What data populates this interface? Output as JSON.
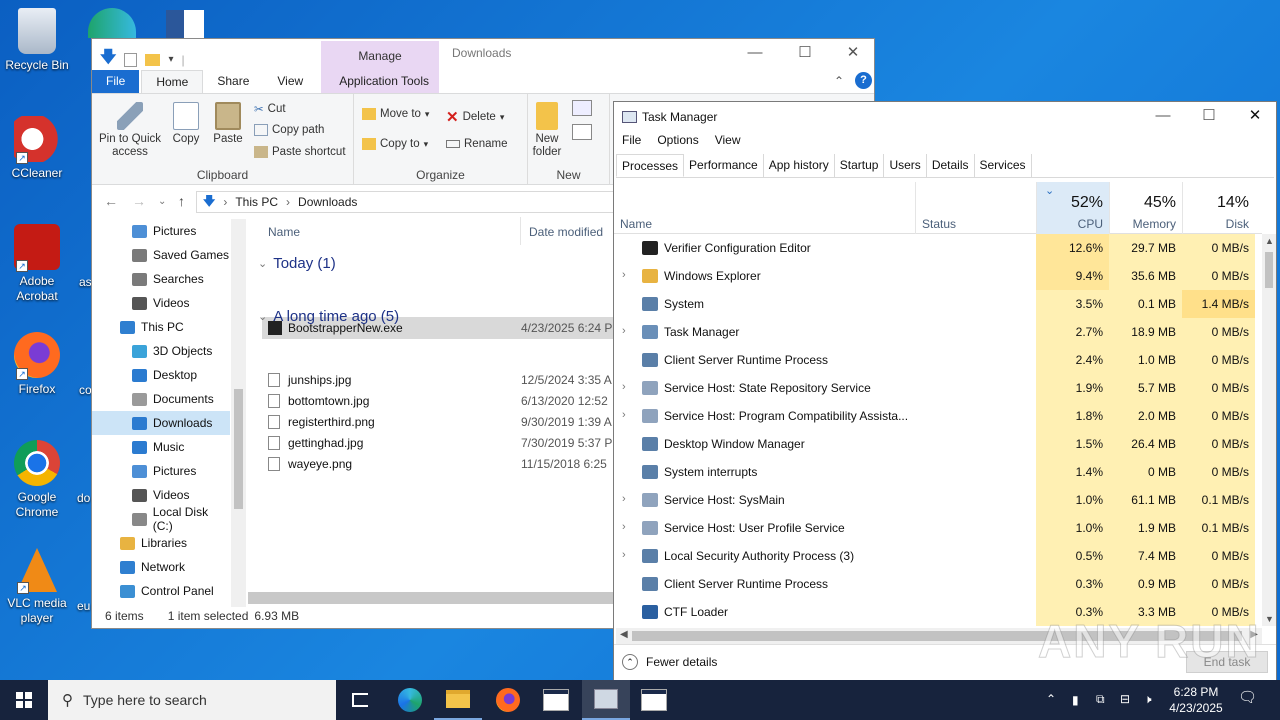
{
  "desktop": {
    "icons": [
      {
        "label": "Recycle Bin",
        "icon": "recycle-bin-icon"
      },
      {
        "label": "CCleaner",
        "icon": "ccleaner-icon"
      },
      {
        "label": "Adobe Acrobat",
        "icon": "acrobat-icon"
      },
      {
        "label": "Firefox",
        "icon": "firefox-icon"
      },
      {
        "label": "Google Chrome",
        "icon": "chrome-icon"
      },
      {
        "label": "VLC media player",
        "icon": "vlc-icon"
      }
    ],
    "partial_labels": [
      "as",
      "co",
      "do",
      "eu"
    ]
  },
  "explorer": {
    "title": "Downloads",
    "manage_label": "Manage",
    "tabs": [
      "File",
      "Home",
      "Share",
      "View",
      "Application Tools"
    ],
    "ribbon": {
      "pin": "Pin to Quick access",
      "copy": "Copy",
      "paste": "Paste",
      "cut": "Cut",
      "copy_path": "Copy path",
      "paste_shortcut": "Paste shortcut",
      "clipboard": "Clipboard",
      "move_to": "Move to",
      "copy_to": "Copy to",
      "delete": "Delete",
      "rename": "Rename",
      "organize": "Organize",
      "new_folder": "New folder",
      "new": "New"
    },
    "address": [
      "This PC",
      "Downloads"
    ],
    "nav": [
      {
        "label": "Pictures",
        "color": "#4d8fd6"
      },
      {
        "label": "Saved Games",
        "color": "#7a7a7a"
      },
      {
        "label": "Searches",
        "color": "#7a7a7a"
      },
      {
        "label": "Videos",
        "color": "#555"
      },
      {
        "label": "This PC",
        "color": "#2f7fd0"
      },
      {
        "label": "3D Objects",
        "color": "#3aa3d9"
      },
      {
        "label": "Desktop",
        "color": "#2b7bd0"
      },
      {
        "label": "Documents",
        "color": "#9a9a9a"
      },
      {
        "label": "Downloads",
        "color": "#2b7bd0"
      },
      {
        "label": "Music",
        "color": "#2b7bd0"
      },
      {
        "label": "Pictures",
        "color": "#4d8fd6"
      },
      {
        "label": "Videos",
        "color": "#555"
      },
      {
        "label": "Local Disk (C:)",
        "color": "#888"
      },
      {
        "label": "Libraries",
        "color": "#e8b341"
      },
      {
        "label": "Network",
        "color": "#2f7fd0"
      },
      {
        "label": "Control Panel",
        "color": "#3b8fd3"
      }
    ],
    "columns": {
      "name": "Name",
      "date": "Date modified"
    },
    "groups": [
      {
        "title": "Today (1)",
        "files": [
          {
            "name": "BootstrapperNew.exe",
            "date": "4/23/2025 6:24 P"
          }
        ]
      },
      {
        "title": "A long time ago (5)",
        "files": [
          {
            "name": "junships.jpg",
            "date": "12/5/2024 3:35 A"
          },
          {
            "name": "bottomtown.jpg",
            "date": "6/13/2020 12:52"
          },
          {
            "name": "registerthird.png",
            "date": "9/30/2019 1:39 A"
          },
          {
            "name": "gettinghad.jpg",
            "date": "7/30/2019 5:37 P"
          },
          {
            "name": "wayeye.png",
            "date": "11/15/2018 6:25"
          }
        ]
      }
    ],
    "status": {
      "items": "6 items",
      "selected": "1 item selected",
      "size": "6.93 MB"
    }
  },
  "taskmgr": {
    "title": "Task Manager",
    "menu": [
      "File",
      "Options",
      "View"
    ],
    "tabs": [
      "Processes",
      "Performance",
      "App history",
      "Startup",
      "Users",
      "Details",
      "Services"
    ],
    "headers": {
      "name": "Name",
      "status": "Status",
      "cpu_pct": "52%",
      "cpu": "CPU",
      "mem_pct": "45%",
      "mem": "Memory",
      "disk_pct": "14%",
      "disk": "Disk"
    },
    "rows": [
      {
        "name": "Verifier Configuration Editor",
        "exp": false,
        "cpu": "12.6%",
        "mem": "29.7 MB",
        "disk": "0 MB/s",
        "icon": "#222"
      },
      {
        "name": "Windows Explorer",
        "exp": true,
        "cpu": "9.4%",
        "mem": "35.6 MB",
        "disk": "0 MB/s",
        "icon": "#e8b341"
      },
      {
        "name": "System",
        "exp": false,
        "cpu": "3.5%",
        "mem": "0.1 MB",
        "disk": "1.4 MB/s",
        "icon": "#5a7fa8"
      },
      {
        "name": "Task Manager",
        "exp": true,
        "cpu": "2.7%",
        "mem": "18.9 MB",
        "disk": "0 MB/s",
        "icon": "#6a8fb8"
      },
      {
        "name": "Client Server Runtime Process",
        "exp": false,
        "cpu": "2.4%",
        "mem": "1.0 MB",
        "disk": "0 MB/s",
        "icon": "#5a7fa8"
      },
      {
        "name": "Service Host: State Repository Service",
        "exp": true,
        "cpu": "1.9%",
        "mem": "5.7 MB",
        "disk": "0 MB/s",
        "icon": "#8fa3bd"
      },
      {
        "name": "Service Host: Program Compatibility Assista...",
        "exp": true,
        "cpu": "1.8%",
        "mem": "2.0 MB",
        "disk": "0 MB/s",
        "icon": "#8fa3bd"
      },
      {
        "name": "Desktop Window Manager",
        "exp": false,
        "cpu": "1.5%",
        "mem": "26.4 MB",
        "disk": "0 MB/s",
        "icon": "#5a7fa8"
      },
      {
        "name": "System interrupts",
        "exp": false,
        "cpu": "1.4%",
        "mem": "0 MB",
        "disk": "0 MB/s",
        "icon": "#5a7fa8"
      },
      {
        "name": "Service Host: SysMain",
        "exp": true,
        "cpu": "1.0%",
        "mem": "61.1 MB",
        "disk": "0.1 MB/s",
        "icon": "#8fa3bd"
      },
      {
        "name": "Service Host: User Profile Service",
        "exp": true,
        "cpu": "1.0%",
        "mem": "1.9 MB",
        "disk": "0.1 MB/s",
        "icon": "#8fa3bd"
      },
      {
        "name": "Local Security Authority Process (3)",
        "exp": true,
        "cpu": "0.5%",
        "mem": "7.4 MB",
        "disk": "0 MB/s",
        "icon": "#5a7fa8"
      },
      {
        "name": "Client Server Runtime Process",
        "exp": false,
        "cpu": "0.3%",
        "mem": "0.9 MB",
        "disk": "0 MB/s",
        "icon": "#5a7fa8"
      },
      {
        "name": "CTF Loader",
        "exp": false,
        "cpu": "0.3%",
        "mem": "3.3 MB",
        "disk": "0 MB/s",
        "icon": "#2a5fa0"
      }
    ],
    "fewer_details": "Fewer details",
    "end_task": "End task"
  },
  "watermark": "ANY RUN",
  "taskbar": {
    "search_placeholder": "Type here to search",
    "time": "6:28 PM",
    "date": "4/23/2025"
  },
  "colors": {
    "cpu_col": "#fff0b3",
    "cpu_hi": "#ffe699",
    "disk_hi": "#ffe08a",
    "accent": "#1a6dd0"
  }
}
